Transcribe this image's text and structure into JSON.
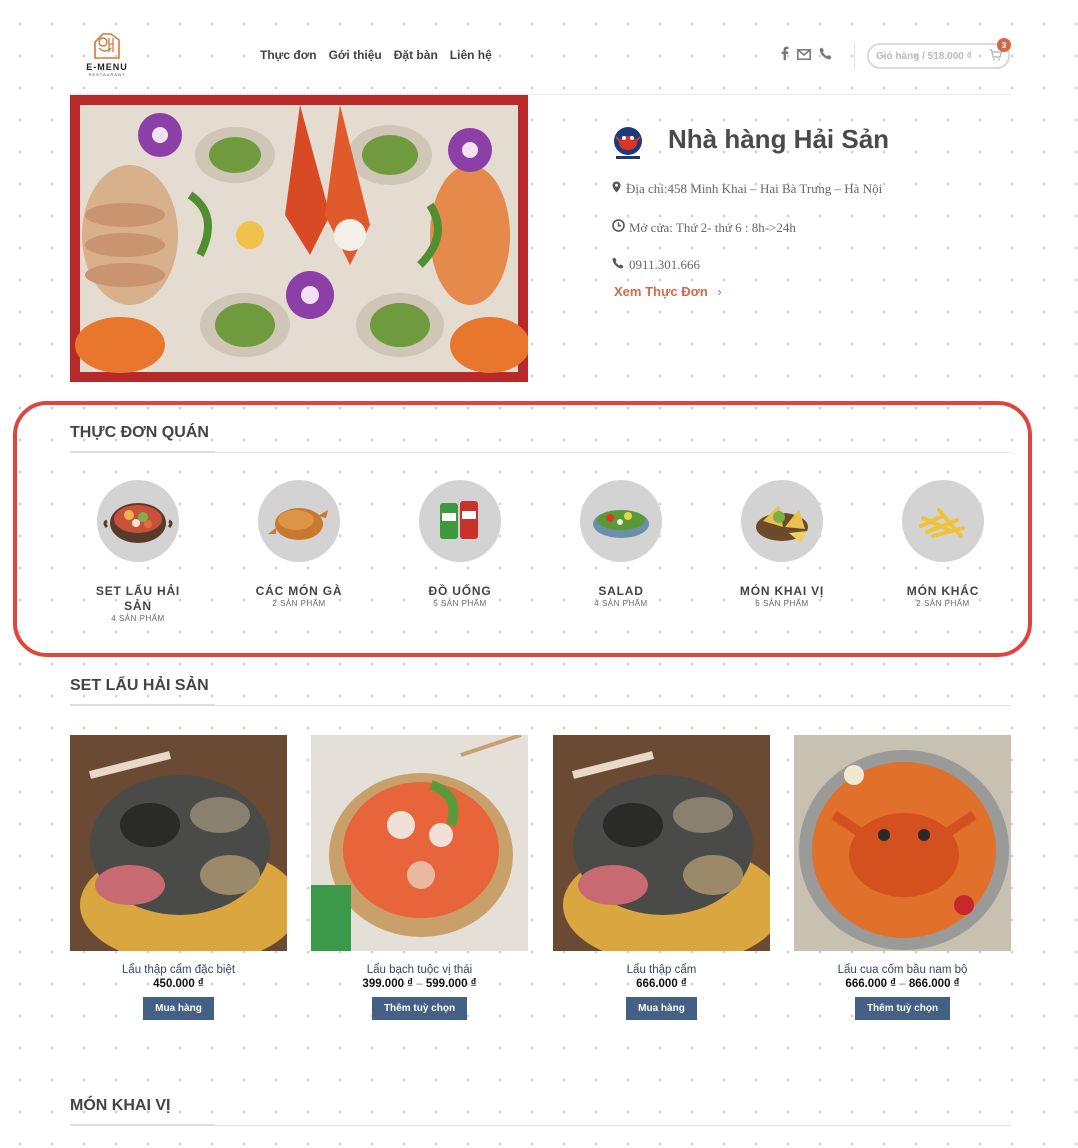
{
  "header": {
    "logo_text": "E-MENU",
    "logo_sub": "RESTAURANT",
    "nav": [
      "Thực đơn",
      "Gới thiệu",
      "Đặt bàn",
      "Liên hệ"
    ],
    "social_icons": [
      "facebook-icon",
      "mail-icon",
      "phone-icon"
    ],
    "cart_label": "Giỏ hàng / 518.000 ₫",
    "cart_count": "3"
  },
  "hero": {
    "restaurant_name": "Nhà hàng Hải Sản",
    "address": "Địa chỉ:458 Minh Khai – Hai Bà Trưng – Hà Nội",
    "hours": "Mở cửa: Thứ 2- thứ 6 : 8h->24h",
    "phone": "0911.301.666",
    "view_menu": "Xem Thực Đơn",
    "view_menu_arrow": "›"
  },
  "menu_section": {
    "title": "THỰC ĐƠN QUÁN",
    "categories": [
      {
        "name": "SET LẨU HẢI SẢN",
        "count": "4 SẢN PHẨM",
        "icon": "hotpot-icon"
      },
      {
        "name": "CÁC MÓN GÀ",
        "count": "2 SẢN PHẨM",
        "icon": "roast-chicken-icon"
      },
      {
        "name": "ĐỒ UỐNG",
        "count": "5 SẢN PHẨM",
        "icon": "drink-cans-icon"
      },
      {
        "name": "SALAD",
        "count": "4 SẢN PHẨM",
        "icon": "salad-bowl-icon"
      },
      {
        "name": "MÓN KHAI VỊ",
        "count": "6 SẢN PHẨM",
        "icon": "appetizer-icon"
      },
      {
        "name": "MÓN KHÁC",
        "count": "2 SẢN PHẨM",
        "icon": "fries-icon"
      }
    ]
  },
  "hotpot_section": {
    "title": "SET LẨU HẢI SẢN",
    "products": [
      {
        "name": "Lẩu thập cẩm đặc biệt",
        "price": "450.000 ₫",
        "price_max": "",
        "button": "Mua hàng"
      },
      {
        "name": "Lẩu bạch tuộc vị thái",
        "price": "399.000 ₫",
        "price_max": "599.000 ₫",
        "button": "Thêm tuỳ chọn"
      },
      {
        "name": "Lẩu thập cẩm",
        "price": "666.000 ₫",
        "price_max": "",
        "button": "Mua hàng"
      },
      {
        "name": "Lẩu cua cốm bầu nam bộ",
        "price": "666.000 ₫",
        "price_max": "866.000 ₫",
        "button": "Thêm tuỳ chọn"
      }
    ]
  },
  "appetizer_section": {
    "title": "MÓN KHAI VỊ"
  },
  "colors": {
    "accent": "#d2694a",
    "button": "#446084",
    "highlight_border": "#e0443f"
  }
}
